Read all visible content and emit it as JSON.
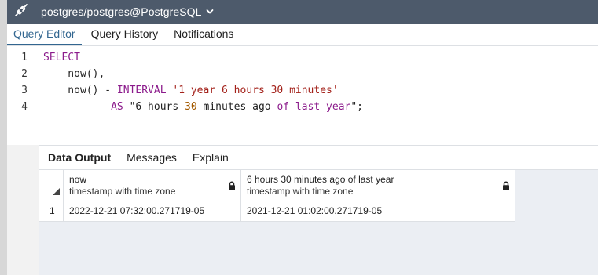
{
  "window": {
    "title": "postgres/postgres@PostgreSQL",
    "icon": "plug-icon",
    "chevron_icon": "chevron-down-icon"
  },
  "tabs": [
    {
      "label": "Query Editor",
      "active": true
    },
    {
      "label": "Query History",
      "active": false
    },
    {
      "label": "Notifications",
      "active": false
    }
  ],
  "editor": {
    "lines": [
      {
        "no": "1",
        "tokens": [
          {
            "t": "SELECT",
            "c": "kw"
          }
        ]
      },
      {
        "no": "2",
        "tokens": [
          {
            "t": "    now(),",
            "c": "plain"
          }
        ]
      },
      {
        "no": "3",
        "tokens": [
          {
            "t": "    now() - ",
            "c": "plain"
          },
          {
            "t": "INTERVAL",
            "c": "kw"
          },
          {
            "t": " ",
            "c": "plain"
          },
          {
            "t": "'1 year 6 hours 30 minutes'",
            "c": "str"
          }
        ]
      },
      {
        "no": "4",
        "tokens": [
          {
            "t": "           ",
            "c": "plain"
          },
          {
            "t": "AS",
            "c": "kw"
          },
          {
            "t": " \"6 hours ",
            "c": "plain"
          },
          {
            "t": "30",
            "c": "num"
          },
          {
            "t": " minutes ago ",
            "c": "plain"
          },
          {
            "t": "of last year",
            "c": "kw"
          },
          {
            "t": "\";",
            "c": "plain"
          }
        ]
      }
    ]
  },
  "results": {
    "tabs": [
      {
        "label": "Data Output",
        "active": true
      },
      {
        "label": "Messages",
        "active": false
      },
      {
        "label": "Explain",
        "active": false
      }
    ],
    "columns": [
      {
        "name": "now",
        "type": "timestamp with time zone",
        "icon": "lock-icon"
      },
      {
        "name": "6 hours 30 minutes ago of last year",
        "type": "timestamp with time zone",
        "icon": "lock-icon"
      }
    ],
    "rows": [
      {
        "num": "1",
        "cells": [
          "2022-12-21 07:32:00.271719-05",
          "2021-12-21 01:02:00.271719-05"
        ]
      }
    ]
  },
  "colors": {
    "titlebar_bg": "#4d5a6b",
    "accent": "#326690",
    "keyword": "#8b1a8b",
    "string": "#a3211a",
    "number": "#a35a00"
  }
}
